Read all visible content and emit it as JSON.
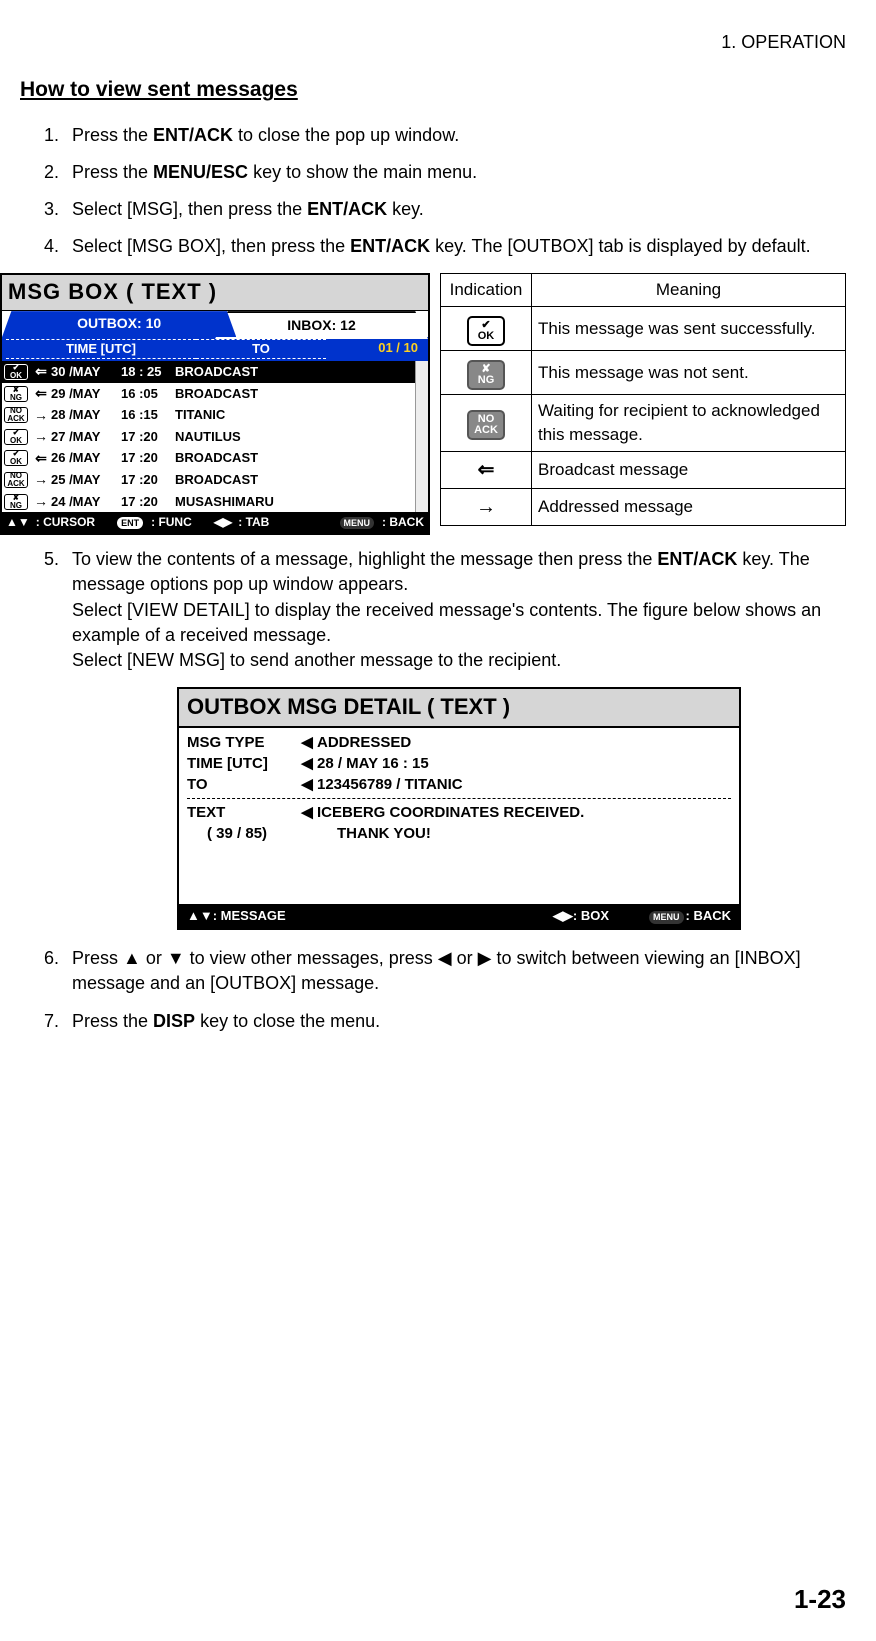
{
  "chapter": "1.  OPERATION",
  "section_title": "How to view sent messages",
  "steps": {
    "s1a": "Press the ",
    "s1b": "ENT/ACK",
    "s1c": " to close the pop up window.",
    "s2a": "Press the ",
    "s2b": "MENU/ESC",
    "s2c": " key to show the main menu.",
    "s3a": "Select [MSG], then press the ",
    "s3b": "ENT/ACK",
    "s3c": " key.",
    "s4a": "Select [MSG BOX], then press the ",
    "s4b": "ENT/ACK",
    "s4c": " key. The [OUTBOX] tab is displayed by default.",
    "s5a": "To view the contents of a message, highlight the message then press the ",
    "s5b": "ENT/ACK",
    "s5c": " key. The message options pop up window appears.",
    "s5d": "Select [VIEW DETAIL] to display the received message's contents. The figure below shows an example of a received message.",
    "s5e": "Select [NEW MSG] to send another message to the recipient.",
    "s6a": "Press ▲ or ▼ to view other messages, press ◀ or ▶ to switch between viewing an [INBOX] message and an [OUTBOX] message.",
    "s7a": "Press the ",
    "s7b": "DISP",
    "s7c": " key to close the menu."
  },
  "msgbox": {
    "title": "MSG  BOX   ( TEXT )",
    "outbox_tab": "OUTBOX: 10",
    "inbox_tab": "INBOX: 12",
    "hdr_time": "TIME [UTC]",
    "hdr_to": "TO",
    "hdr_count": "01 / 10",
    "rows": [
      {
        "status_top": "✔",
        "status_bot": "OK",
        "dir": "⇐",
        "date": "30 /MAY",
        "time": "18 : 25",
        "to": "BROADCAST",
        "sel": true
      },
      {
        "status_top": "✘",
        "status_bot": "NG",
        "dir": "⇐",
        "date": "29 /MAY",
        "time": "16 :05",
        "to": "BROADCAST"
      },
      {
        "status_top": "NO",
        "status_bot": "ACK",
        "dir": "→",
        "date": "28 /MAY",
        "time": "16 :15",
        "to": "TITANIC"
      },
      {
        "status_top": "✔",
        "status_bot": "OK",
        "dir": "→",
        "date": "27 /MAY",
        "time": "17 :20",
        "to": "NAUTILUS"
      },
      {
        "status_top": "✔",
        "status_bot": "OK",
        "dir": "⇐",
        "date": "26 /MAY",
        "time": "17 :20",
        "to": "BROADCAST"
      },
      {
        "status_top": "NO",
        "status_bot": "ACK",
        "dir": "→",
        "date": "25 /MAY",
        "time": "17 :20",
        "to": "BROADCAST"
      },
      {
        "status_top": "✘",
        "status_bot": "NG",
        "dir": "→",
        "date": "24 /MAY",
        "time": "17 :20",
        "to": "MUSASHIMARU"
      }
    ],
    "foot_cursor": ": CURSOR",
    "foot_func_pill": "ENT",
    "foot_func": ": FUNC",
    "foot_tab": ": TAB",
    "foot_back_pill": "MENU",
    "foot_back": ": BACK"
  },
  "ind_table": {
    "h1": "Indication",
    "h2": "Meaning",
    "r1_top": "✔",
    "r1_bot": "OK",
    "r1_m": "This message was sent successfully.",
    "r2_top": "✘",
    "r2_bot": "NG",
    "r2_m": "This message was not sent.",
    "r3_top": "NO",
    "r3_bot": "ACK",
    "r3_m": "Waiting for recipient to acknowledged this message.",
    "r4_sym": "⇐",
    "r4_m": "Broadcast message",
    "r5_sym": "→",
    "r5_m": "Addressed message"
  },
  "detail": {
    "title": "OUTBOX MSG DETAIL ( TEXT )",
    "l_type": "MSG  TYPE",
    "v_type": "ADDRESSED",
    "l_time": "TIME [UTC]",
    "v_time": "28 / MAY    16 : 15",
    "l_to": "TO",
    "v_to": "123456789 / TITANIC",
    "l_text": "TEXT",
    "l_count": "( 39 / 85)",
    "v_text1": "ICEBERG COORDINATES RECEIVED.",
    "v_text2": "THANK YOU!",
    "foot_msg": ": MESSAGE",
    "foot_box": ": BOX",
    "foot_back_pill": "MENU",
    "foot_back": ": BACK"
  },
  "page_num": "1-23"
}
